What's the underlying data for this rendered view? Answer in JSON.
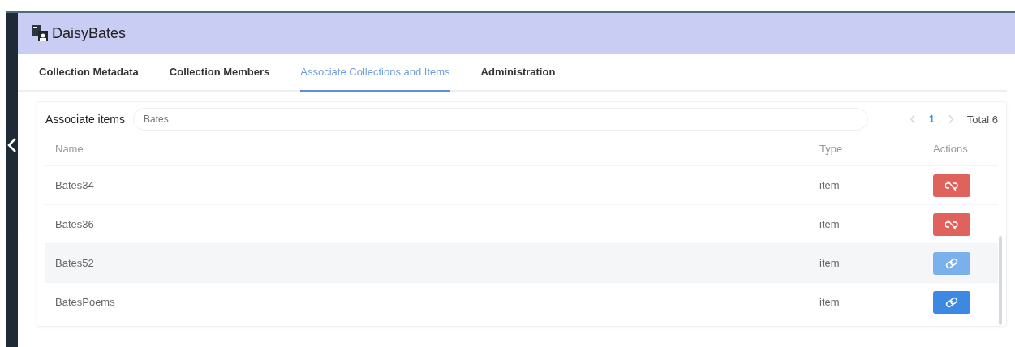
{
  "app": {
    "title": "DaisyBates"
  },
  "tabs": [
    {
      "label": "Collection Metadata",
      "selected": false
    },
    {
      "label": "Collection Members",
      "selected": false
    },
    {
      "label": "Associate Collections and Items",
      "selected": true
    },
    {
      "label": "Administration",
      "selected": false
    }
  ],
  "search": {
    "label": "Associate items",
    "value": "Bates"
  },
  "pagination": {
    "pages": [
      {
        "label": "1",
        "selected": true
      }
    ],
    "total": "Total 6"
  },
  "table": {
    "columns": [
      "Name",
      "Type",
      "Actions"
    ],
    "rows": [
      {
        "name": "Bates34",
        "type": "item",
        "associated": true,
        "hovered": false
      },
      {
        "name": "Bates36",
        "type": "item",
        "associated": true,
        "hovered": false
      },
      {
        "name": "Bates52",
        "type": "item",
        "associated": false,
        "hovered": true
      },
      {
        "name": "BatesPoems",
        "type": "item",
        "associated": false,
        "hovered": false
      }
    ]
  }
}
